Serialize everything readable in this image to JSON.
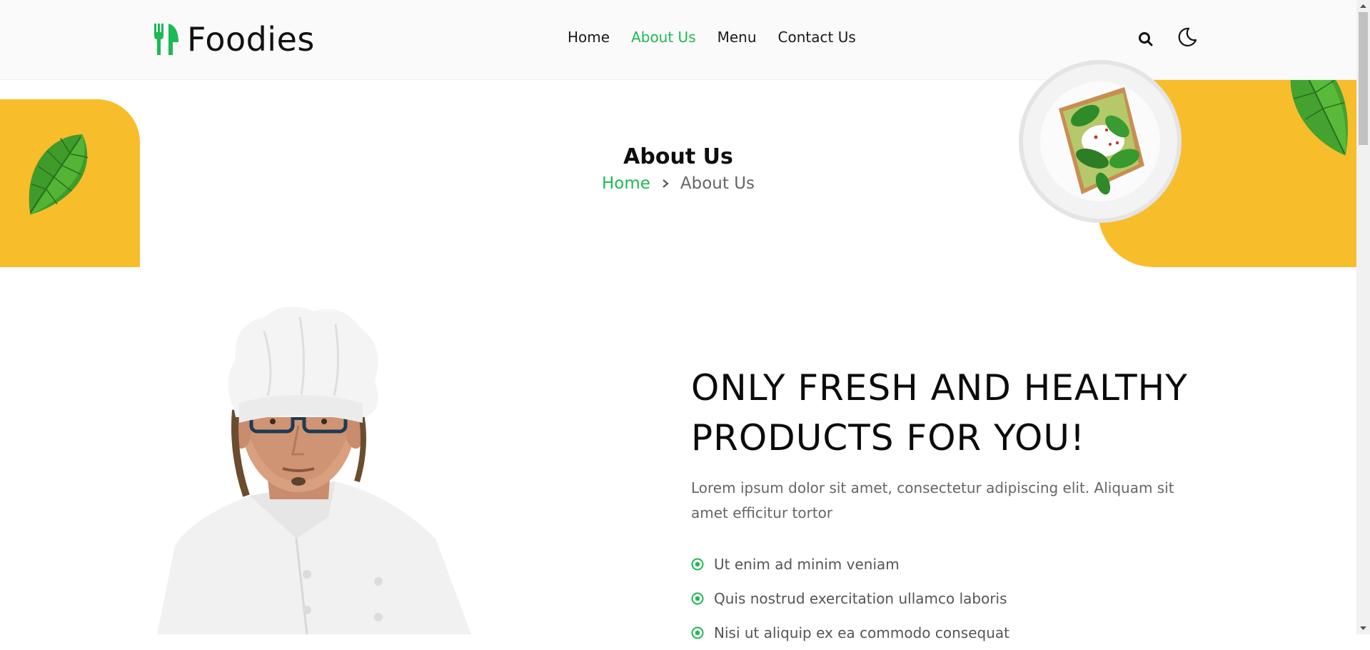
{
  "brand": {
    "name": "Foodies",
    "logo_icon": "fork-knife-icon"
  },
  "nav": {
    "items": [
      {
        "label": "Home",
        "active": false
      },
      {
        "label": "About Us",
        "active": true
      },
      {
        "label": "Menu",
        "active": false
      },
      {
        "label": "Contact Us",
        "active": false
      }
    ]
  },
  "header_actions": {
    "search_icon": "search-icon",
    "theme_icon": "moon-icon"
  },
  "page": {
    "title": "About Us",
    "breadcrumb": {
      "home": "Home",
      "current": "About Us"
    }
  },
  "about": {
    "headline_line1": "ONLY FRESH AND HEALTHY",
    "headline_line2": "PRODUCTS FOR YOU!",
    "lead": "Lorem ipsum dolor sit amet, consectetur adipiscing elit. Aliquam sit amet efficitur tortor",
    "features": [
      "Ut enim ad minim veniam",
      "Quis nostrud exercitation ullamco laboris",
      "Nisi ut aliquip ex ea commodo consequat"
    ]
  },
  "colors": {
    "accent": "#1db954",
    "yellow": "#f8bd2b",
    "text": "#111111",
    "muted": "#666666"
  }
}
